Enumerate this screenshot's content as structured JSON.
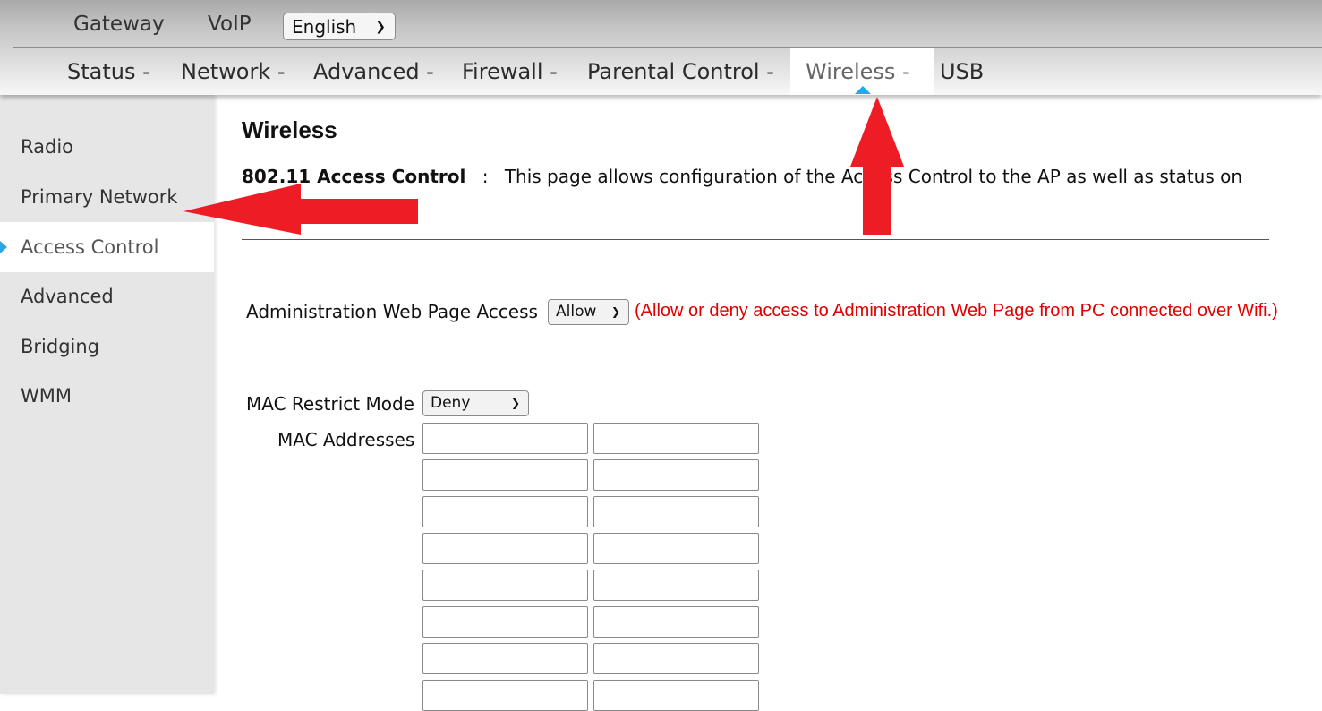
{
  "top_nav": {
    "gateway": "Gateway",
    "voip": "VoIP",
    "language": {
      "selected": "English"
    }
  },
  "main_nav": {
    "items": [
      {
        "label": "Status -"
      },
      {
        "label": "Network -"
      },
      {
        "label": "Advanced -"
      },
      {
        "label": "Firewall -"
      },
      {
        "label": "Parental Control -"
      },
      {
        "label": "Wireless -",
        "active": true
      },
      {
        "label": "USB"
      }
    ]
  },
  "sidebar": {
    "items": [
      {
        "label": "Radio"
      },
      {
        "label": "Primary Network"
      },
      {
        "label": "Access Control",
        "active": true
      },
      {
        "label": "Advanced"
      },
      {
        "label": "Bridging"
      },
      {
        "label": "WMM"
      }
    ]
  },
  "content": {
    "title": "Wireless",
    "desc_heading": "802.11 Access Control",
    "desc_sep": ":",
    "desc_text": "This page allows configuration of the Access Control to the AP as well as status on",
    "admin_access": {
      "label": "Administration Web Page Access",
      "selected": "Allow",
      "note": "(Allow or deny access to Administration Web Page from PC connected over Wifi.)"
    },
    "mac_restrict": {
      "label": "MAC Restrict Mode",
      "selected": "Deny"
    },
    "mac_addresses": {
      "label": "MAC Addresses",
      "values": [
        "",
        "",
        "",
        "",
        "",
        "",
        "",
        "",
        "",
        "",
        "",
        "",
        "",
        "",
        "",
        ""
      ]
    }
  },
  "colors": {
    "accent_blue": "#2aa6e6",
    "note_red": "#e00000",
    "annotation_arrow_red": "#ee1c25"
  }
}
